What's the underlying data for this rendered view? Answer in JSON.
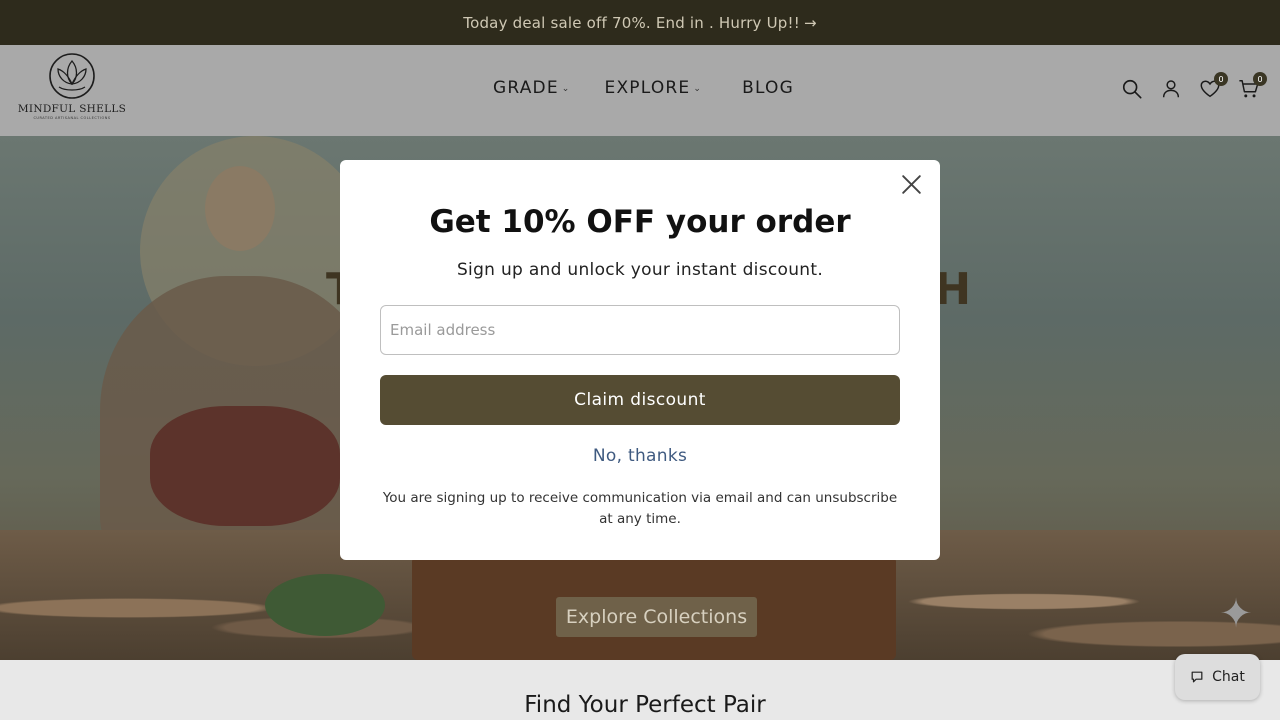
{
  "announcement": {
    "text": "Today deal sale off 70%. End in . Hurry Up!!",
    "arrow": "→"
  },
  "header": {
    "logo": {
      "brand": "MINDFUL SHELLS",
      "tagline": "CURATED ARTISANAL COLLECTIONS"
    },
    "nav": [
      {
        "label": "GRADE",
        "has_dropdown": true
      },
      {
        "label": "EXPLORE",
        "has_dropdown": true
      },
      {
        "label": "BLOG",
        "has_dropdown": false
      }
    ],
    "icons": {
      "search": "search-icon",
      "account": "account-icon",
      "wishlist": "heart-icon",
      "cart": "cart-icon"
    },
    "wishlist_count": "0",
    "cart_count": "0"
  },
  "hero": {
    "heading_left": "T",
    "heading_right": "CH",
    "cta_label": "Explore Collections"
  },
  "section": {
    "title": "Find Your Perfect Pair"
  },
  "chat": {
    "label": "Chat",
    "icon": "chat-bubble-icon"
  },
  "modal": {
    "title": "Get 10% OFF your order",
    "subtitle": "Sign up and unlock your instant discount.",
    "email_placeholder": "Email address",
    "email_value": "",
    "claim_label": "Claim discount",
    "decline_label": "No, thanks",
    "legal": "You are signing up to receive communication via email and can unsubscribe at any time."
  },
  "colors": {
    "accent": "#554c33",
    "announcement_bg": "#2e2b1c",
    "link": "#3f5a80"
  }
}
